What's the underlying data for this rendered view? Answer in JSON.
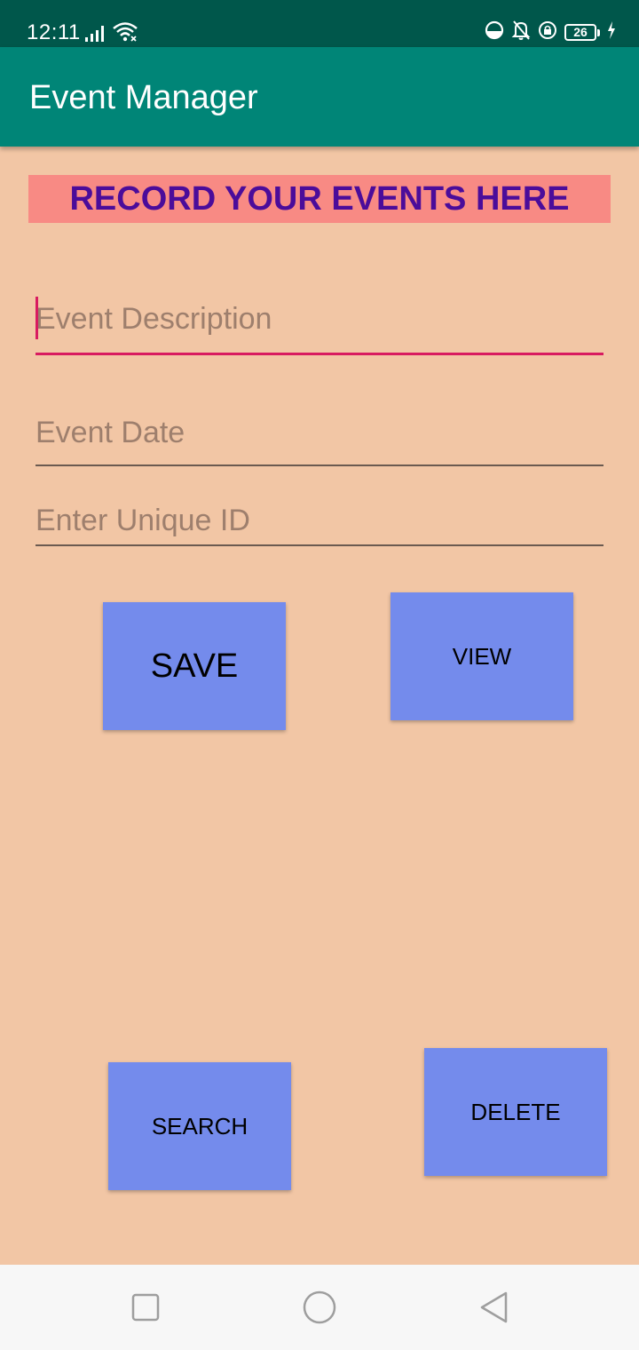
{
  "status_bar": {
    "time": "12:11",
    "battery_level": "26",
    "icons": [
      "signal-icon",
      "wifi-icon",
      "data-saver-icon",
      "bell-off-icon",
      "lock-rotation-icon",
      "battery-icon",
      "charging-icon"
    ]
  },
  "app_bar": {
    "title": "Event Manager",
    "color": "#008577"
  },
  "banner": {
    "text": "RECORD YOUR EVENTS HERE",
    "background": "#F88A84",
    "text_color": "#4B0C9A"
  },
  "form": {
    "description": {
      "placeholder": "Event Description",
      "value": ""
    },
    "date": {
      "placeholder": "Event Date",
      "value": ""
    },
    "unique_id": {
      "placeholder": "Enter Unique ID",
      "value": ""
    }
  },
  "buttons": {
    "save": "SAVE",
    "view": "VIEW",
    "search": "SEARCH",
    "delete": "DELETE",
    "color": "#748BEC"
  },
  "nav_bar": {
    "icons": [
      "recent-apps-icon",
      "home-icon",
      "back-icon"
    ]
  },
  "colors": {
    "background": "#F2C6A5",
    "accent": "#D81B60",
    "status_bar": "#00574B"
  }
}
